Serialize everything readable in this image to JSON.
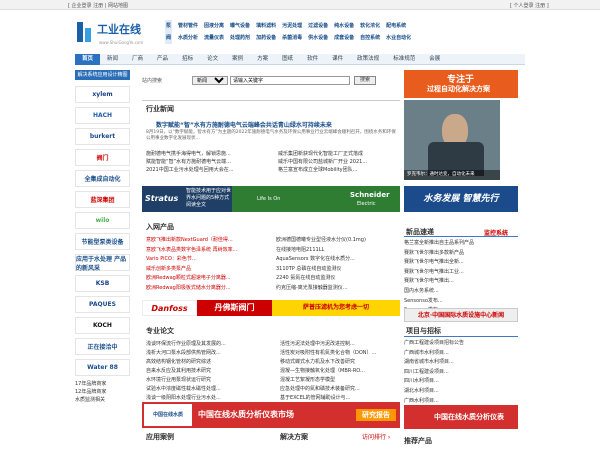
{
  "topbar": {
    "left": "[ 企业登录  注册 | 网站地图",
    "right": "[ 个人登录  注册 ]"
  },
  "logo": {
    "name": "工业在线",
    "url": "www.ShuiGongYe.com"
  },
  "categories": {
    "row1": [
      "泵",
      "管材管件",
      "固液分离",
      "曝气设备",
      "填料滤料",
      "污泥处理",
      "过滤设备",
      "纯水设备",
      "软化浓化",
      "配电系统"
    ],
    "row2": [
      "阀",
      "水质分析",
      "流量仪表",
      "处理药剂",
      "加药设备",
      "杀菌消毒",
      "供水设备",
      "成套设备",
      "自控系统",
      "水业自动化"
    ]
  },
  "nav": [
    "首页",
    "新闻",
    "厂商",
    "产品",
    "招标",
    "论文",
    "案例",
    "方案",
    "图纸",
    "软件",
    "课件",
    "政策法规",
    "标准规范",
    "会展"
  ],
  "sidebar": {
    "title": "解决系统应用设计精图",
    "brands": [
      "xylem",
      "HACH",
      "burkert",
      "阀门",
      "全集成自动化",
      "蓝深集团",
      "wilo",
      "节能型泵类设备",
      "应用于水处理 产品的新风采",
      "KSB",
      "PAQUES",
      "KOCH",
      "正在接洽中",
      "Water 88"
    ],
    "footer": [
      "17年品牌商家",
      "12年品牌商家",
      "水质监测相关"
    ]
  },
  "search": {
    "label": "站内搜索",
    "select": "新闻",
    "input": "请输入关键字",
    "button": "搜索"
  },
  "industry_news": {
    "title": "行业新闻",
    "headline": "数字赋能“智”水有方施耐德电气云端峰会共话青山绿水可持续未来",
    "desc": "8月19日，以“数字赋能，智水有方”为主题的2022年施耐德电气水务及环保公用事业行业云端峰会顺利召开，围绕水务和环保公用事业数字化发展现状...",
    "items": [
      {
        "left": "施耐德电气携手海得电气，解锁思施...",
        "right": "威乐集团新获现代化智能工厂正式落成"
      },
      {
        "left": "赋能智能“智”水有方施耐德电气云端...",
        "right": "威乐中国有限公司盐城新厂开业 2021..."
      },
      {
        "left": "2021中国工业污水处理与回用大会在...",
        "right": "格兰富宣布成立全球Mobility团队..."
      }
    ]
  },
  "photo_caption": "罗克韦尔：通时达变，自动化未来",
  "banners": {
    "right1": {
      "line1": "专注于",
      "line2": "过程自动化解决方案"
    },
    "stratus": {
      "brand": "Stratus",
      "text": "智能技术用于应对世界水问题的5种方式 阅读全文"
    },
    "schneider": {
      "left": "Life Is On",
      "brand": "Schneider",
      "sub": "Electric"
    },
    "right2": "水务发展 智慧先行"
  },
  "products": {
    "title": "入网产品",
    "left": [
      "意欧飞推出新款NextGuard（耐佳得...",
      "意欧飞水表品类数字色泽系统 再树效率...",
      "Vario PiCO：彩色节...",
      "威乐创新多类泵产品",
      "欧洲Redwag颗粒式超速电子分离器...",
      "欧洲Redwag阳极板式储水分离器分..."
    ],
    "right": [
      "欧洲德国德曦专业型径液水分仪(0.1mg)",
      "在线接地电阻2111LL",
      "AquaSensors 数字化在线水质分...",
      "3110TP 总磷在线自动监测仪",
      "2240 氨氮在线自动监测仪",
      "约克压缩-离光泵接触器监测仪..."
    ]
  },
  "ad_strip": {
    "danfoss": "Danfoss",
    "red": "丹佛斯阀门",
    "yellow": "萨普压滤机为您考虑一切"
  },
  "papers": {
    "title": "专业论文",
    "left": [
      "浅谈环保流行作业原理及其发展的...",
      "浅析大河口泵水段部供热管网改...",
      "高效结构钢化管材的研究综述",
      "自来水反应及其利用技术研究",
      "水环境行业用泵现状运行研究",
      "试验水中浓度磁性载水磁性处理...",
      "浅谈一级阴阳水处理行业污水处..."
    ],
    "right": [
      "活性污泥法处理中污泥改进控制...",
      "活性炭对吸附性有机氮类化合物（DON）...",
      "移动式蝶式水力机及水下改善研究",
      "混凝—生物接触氧化处理（MBR-RO...",
      "混凝工艺絮凝形态学模型",
      "应急处理中的氮和磷技术装备研究...",
      "基于EXCEL的管网辅助设计与..."
    ]
  },
  "ad_big": {
    "logo": "中国在线水质",
    "text": "中国在线水质分析仪表市场",
    "btn": "研究报告"
  },
  "right_news": {
    "title": "新品速递",
    "tag": "监控系统",
    "items": [
      "格兰富全新推出自主品系列产品",
      "赛默飞世尔推出多款新产品",
      "赛默飞世尔电气推出全新...",
      "赛默飞世尔电气推出工业...",
      "赛默飞世尔电气推出...",
      "国内水务系统...",
      "Sensonso发布...",
      "Sensonso发布..."
    ]
  },
  "bj_bar": "北京·中国国际水质设施中心新闻",
  "bids": {
    "title": "项目与招标",
    "items": [
      "广西工程建设项目招标公告",
      "广西城市水利项目...",
      "湖南省城市水利项目...",
      "四川工程建设项目...",
      "四川水利项目...",
      "湖北水利项目...",
      "广西水利项目..."
    ]
  },
  "ad_right3": "中国在线水质分析仪表",
  "bottom": {
    "app": "应用案例",
    "sol": "解决方案",
    "sol_more": "访问排行 ›",
    "rec": "推荐产品"
  }
}
